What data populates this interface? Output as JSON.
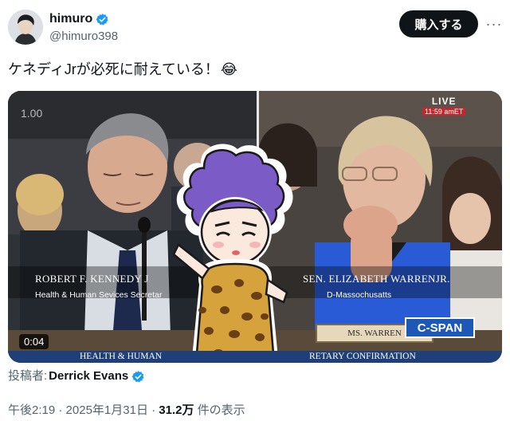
{
  "author": {
    "name": "himuro",
    "handle": "@himuro398",
    "verified_icon": "verified-badge-icon",
    "verified_color": "#1d9bf0"
  },
  "header": {
    "buy_label": "購入する",
    "more_icon": "more-dots-icon",
    "more_glyph": "···"
  },
  "tweet": {
    "text": "ケネディJrが必死に耐えている！",
    "emoji": "😂"
  },
  "media": {
    "speed_text": "1.00",
    "live_label": "LIVE",
    "live_time": "11:59 amET",
    "left_caption_name": "ROBERT F. KENNEDY J",
    "left_caption_role": "Health & Human Sevices Secretar",
    "right_caption_name": "SEN. ELIZABETH WARRENJR.",
    "right_caption_role": "D-Massochusatts",
    "nameplate": "MS. WARREN",
    "network_logo": "C-SPAN",
    "banner_left": "HEALTH & HUMAN",
    "banner_right": "RETARY CONFIRMATION",
    "duration": "0:04",
    "colors": {
      "banner": "#1e3f78",
      "cspan": "#1d58b7",
      "live": "#c1272d",
      "blazer": "#2a5bd7"
    }
  },
  "poster": {
    "label": "投稿者:",
    "name": "Derrick Evans"
  },
  "meta": {
    "time": "午後2:19",
    "separator": " · ",
    "date": "2025年1月31日",
    "views": "31.2万",
    "views_suffix": " 件の表示"
  },
  "colors": {
    "text": "#0f1419",
    "secondary": "#536471",
    "button_bg": "#0f1419"
  }
}
